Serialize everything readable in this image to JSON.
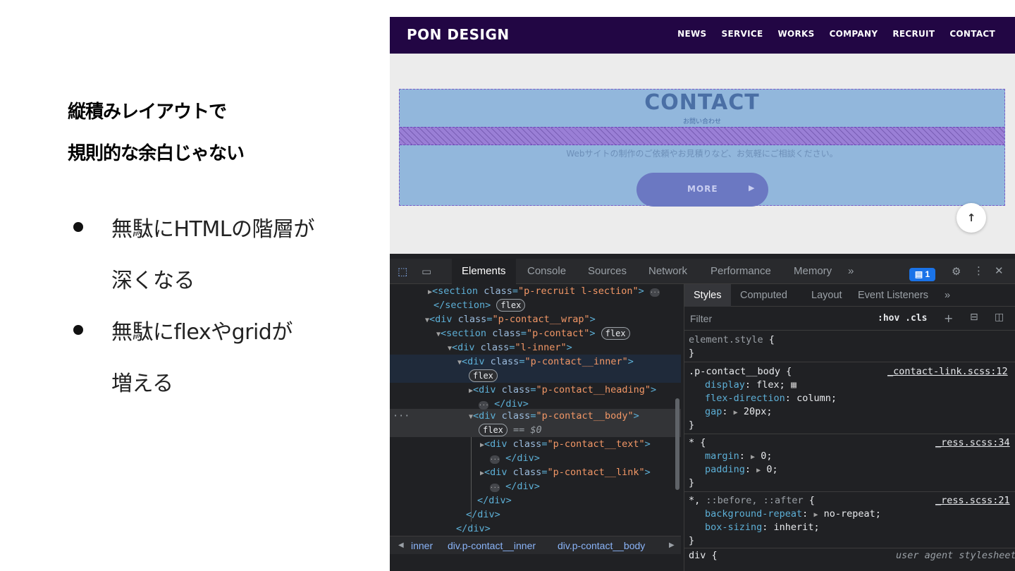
{
  "slide": {
    "heading_line1": "縦積みレイアウトで",
    "heading_line2": "規則的な余白じゃない",
    "bullets": [
      {
        "line1": "無駄にHTMLの階層が",
        "line2": "深くなる"
      },
      {
        "line1": "無駄にflexやgridが",
        "line2": "増える"
      }
    ]
  },
  "site": {
    "logo": "PON DESIGN",
    "nav": [
      "NEWS",
      "SERVICE",
      "WORKS",
      "COMPANY",
      "RECRUIT",
      "CONTACT"
    ],
    "contact_title": "CONTACT",
    "contact_subtitle": "お問い合わせ",
    "contact_text": "Webサイトの制作のご依頼やお見積りなど、お気軽にご相談ください。",
    "more_label": "MORE",
    "colors": {
      "header": "#220644",
      "inner_box": "#92b7dc",
      "gap_band": "#9a7fd6",
      "button": "#6b78c2"
    }
  },
  "devtools": {
    "tabs": [
      "Elements",
      "Console",
      "Sources",
      "Network",
      "Performance",
      "Memory"
    ],
    "active_tab": "Elements",
    "issues_count": "1",
    "dom": {
      "recruit_class": "\"p-recruit l-section\"",
      "contact_wrap_class": "\"p-contact__wrap\"",
      "contact_class": "\"p-contact\"",
      "inner_class": "\"l-inner\"",
      "contact_inner_class": "\"p-contact__inner\"",
      "heading_class": "\"p-contact__heading\"",
      "body_class": "\"p-contact__body\"",
      "text_class": "\"p-contact__text\"",
      "link_class": "\"p-contact__link\"",
      "flex_badge": "flex",
      "selected_marker": "== $0"
    },
    "breadcrumb": [
      "inner",
      "div.p-contact__inner",
      "div.p-contact__body"
    ],
    "styles_tabs": [
      "Styles",
      "Computed",
      "Layout",
      "Event Listeners"
    ],
    "filter_placeholder": "Filter",
    "filter_tools": ":hov  .cls",
    "rules": {
      "element_style": "element.style",
      "body_selector": ".p-contact__body",
      "body_source": "_contact-link.scss:12",
      "body_props": [
        {
          "name": "display",
          "value": "flex;"
        },
        {
          "name": "flex-direction",
          "value": "column;"
        },
        {
          "name": "gap",
          "value": "20px;"
        }
      ],
      "star_selector": "*",
      "star_source": "_ress.scss:34",
      "star_props": [
        {
          "name": "margin",
          "value": "0;"
        },
        {
          "name": "padding",
          "value": "0;"
        }
      ],
      "before_selector_star": "*,",
      "before_selector_rest": "::before, ::after",
      "before_source": "_ress.scss:21",
      "before_props": [
        {
          "name": "background-repeat",
          "value": "no-repeat;"
        },
        {
          "name": "box-sizing",
          "value": "inherit;"
        }
      ],
      "div_selector": "div {",
      "div_source": "user agent stylesheet"
    }
  }
}
